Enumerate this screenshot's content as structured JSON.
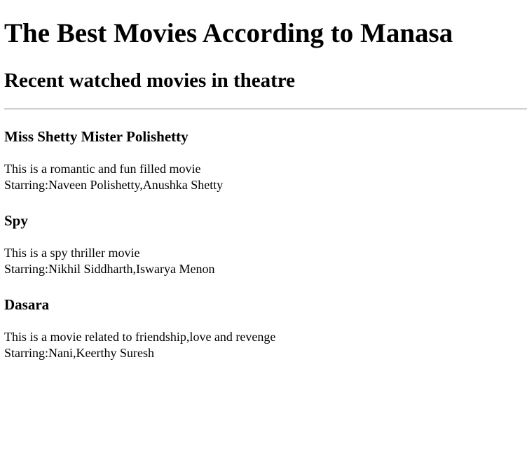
{
  "page": {
    "title": "The Best Movies According to Manasa",
    "subtitle": "Recent watched movies in theatre"
  },
  "movies": [
    {
      "name": "Miss Shetty Mister Polishetty",
      "description": "This is a romantic and fun filled movie",
      "starring": "Starring:Naveen Polishetty,Anushka Shetty"
    },
    {
      "name": "Spy",
      "description": "This is a spy thriller movie",
      "starring": "Starring:Nikhil Siddharth,Iswarya Menon"
    },
    {
      "name": "Dasara",
      "description": "This is a movie related to friendship,love and revenge",
      "starring": "Starring:Nani,Keerthy Suresh"
    }
  ]
}
